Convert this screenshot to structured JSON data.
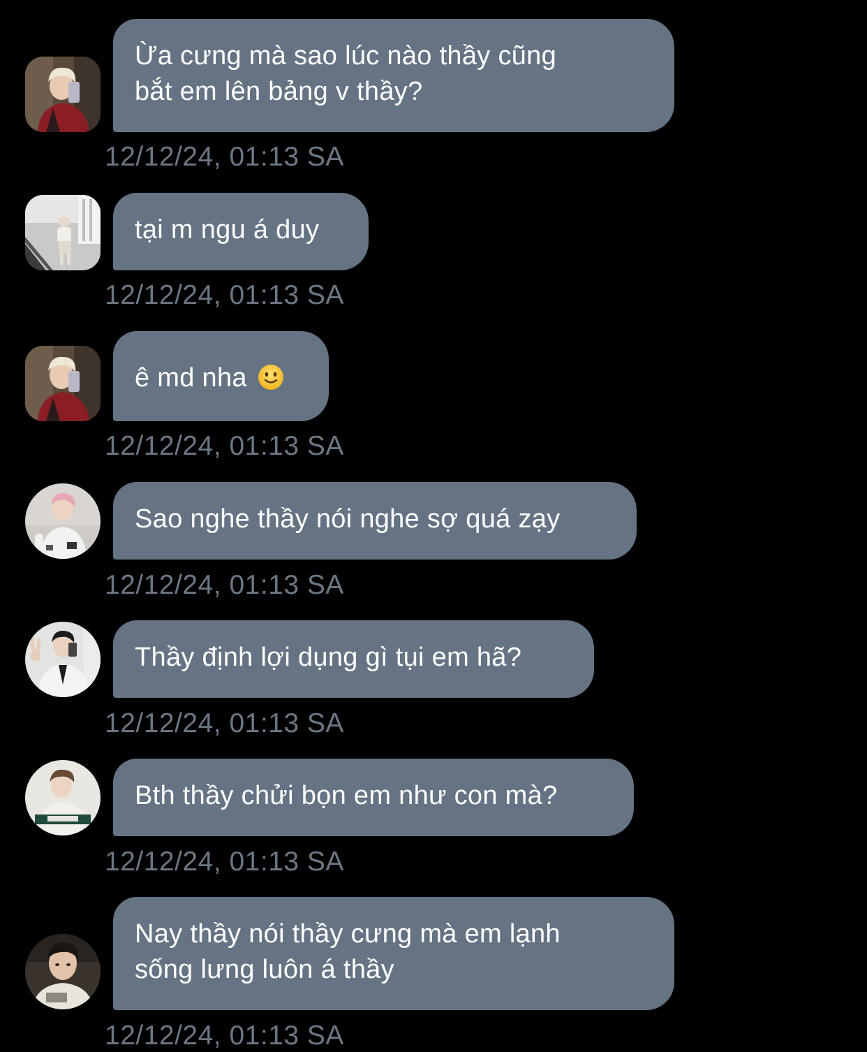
{
  "messages": [
    {
      "avatar": "avatar-blond-mirror-selfie",
      "text": "Ừa cưng mà sao lúc nào thầy cũng\nbắt em lên bảng v thầy?",
      "time": "12/12/24, 01:13 SA"
    },
    {
      "avatar": "avatar-street-sitting",
      "text": "tại m ngu á duy",
      "time": "12/12/24, 01:13 SA"
    },
    {
      "avatar": "avatar-blond-mirror-selfie",
      "text": "ê md nha",
      "emoji": "slightly-smiling-face-icon",
      "time": "12/12/24, 01:13 SA"
    },
    {
      "avatar": "avatar-pink-hair",
      "text": "Sao nghe thầy nói nghe sợ quá zạy",
      "time": "12/12/24, 01:13 SA"
    },
    {
      "avatar": "avatar-peace-sign-white-jacket",
      "text": "Thầy định lợi dụng gì tụi em hã?",
      "time": "12/12/24, 01:13 SA"
    },
    {
      "avatar": "avatar-green-sweater",
      "text": "Bth thầy chửi bọn em như con mà?",
      "time": "12/12/24, 01:13 SA"
    },
    {
      "avatar": "avatar-close-up-selfie",
      "text": "Nay thầy nói thầy cưng mà em lạnh\nsống lưng luôn á thầy",
      "time": "12/12/24, 01:13 SA"
    }
  ],
  "colors": {
    "background": "#000000",
    "bubble": "#657383",
    "bubble_text": "#ffffff",
    "timestamp": "#6b7784"
  }
}
